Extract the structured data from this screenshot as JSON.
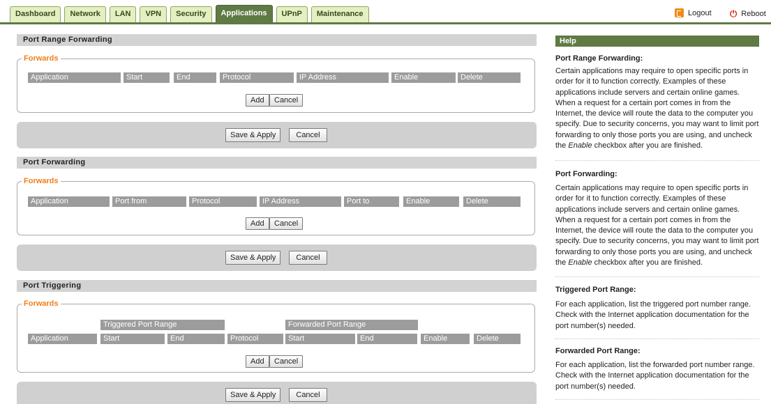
{
  "nav": {
    "tabs": [
      "Dashboard",
      "Network",
      "LAN",
      "VPN",
      "Security",
      "Applications",
      "UPnP",
      "Maintenance"
    ],
    "active_tab": "Applications",
    "logout": "Logout",
    "reboot": "Reboot"
  },
  "sections": {
    "range": {
      "title": "Port Range Forwarding",
      "legend": "Forwards",
      "columns": [
        "Application",
        "Start",
        "End",
        "Protocol",
        "IP Address",
        "Enable",
        "Delete"
      ]
    },
    "port": {
      "title": "Port Forwarding",
      "legend": "Forwards",
      "columns": [
        "Application",
        "Port from",
        "Protocol",
        "IP Address",
        "Port to",
        "Enable",
        "Delete"
      ]
    },
    "trigger": {
      "title": "Port Triggering",
      "legend": "Forwards",
      "group_headers": [
        "Triggered Port Range",
        "Forwarded Port Range"
      ],
      "columns": [
        "Application",
        "Start",
        "End",
        "Protocol",
        "Start",
        "End",
        "Enable",
        "Delete"
      ]
    }
  },
  "buttons": {
    "add": "Add",
    "cancel": "Cancel",
    "save_apply": "Save & Apply"
  },
  "help": {
    "title": "Help",
    "items": [
      {
        "title": "Port Range Forwarding:",
        "text": "Certain applications may require to open specific ports in order for it to function correctly. Examples of these applications include servers and certain online games. When a request for a certain port comes in from the Internet, the device will route the data to the computer you specify. Due to security concerns, you may want to limit port forwarding to only those ports you are using, and uncheck the ",
        "em": "Enable",
        "tail": " checkbox after you are finished."
      },
      {
        "title": "Port Forwarding:",
        "text": "Certain applications may require to open specific ports in order for it to function correctly. Examples of these applications include servers and certain online games. When a request for a certain port comes in from the Internet, the device will route the data to the computer you specify. Due to security concerns, you may want to limit port forwarding to only those ports you are using, and uncheck the ",
        "em": "Enable",
        "tail": " checkbox after you are finished."
      },
      {
        "title": "Triggered Port Range:",
        "text": "For each application, list the triggered port number range. Check with the Internet application documentation for the port number(s) needed."
      },
      {
        "title": "Forwarded Port Range:",
        "text": "For each application, list the forwarded port number range. Check with the Internet application documentation for the port number(s) needed."
      }
    ]
  }
}
